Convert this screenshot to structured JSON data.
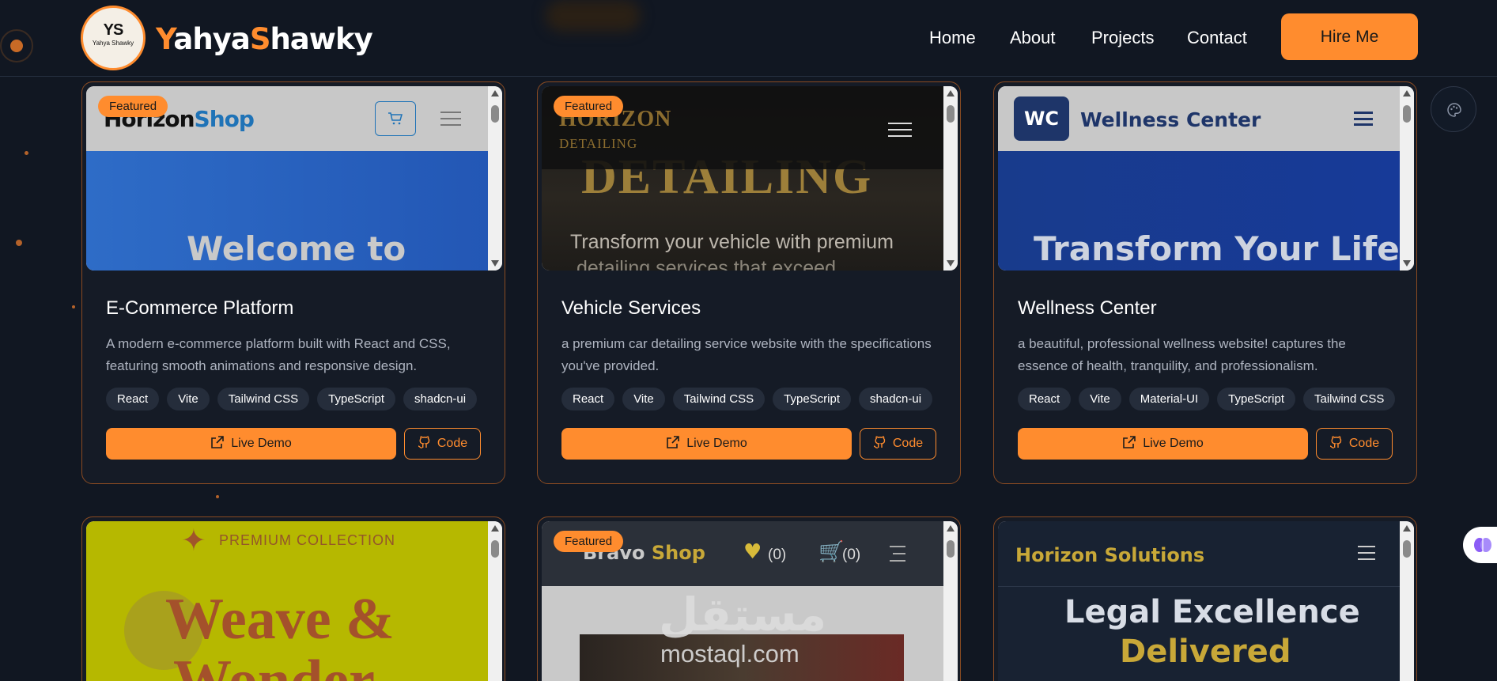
{
  "header": {
    "logo_initials": "YS",
    "logo_sub": "Yahya Shawky",
    "brand_first_initial": "Y",
    "brand_first_rest": "ahya",
    "brand_last_initial": "S",
    "brand_last_rest": "hawky",
    "nav": [
      "Home",
      "About",
      "Projects",
      "Contact"
    ],
    "cta": "Hire Me"
  },
  "badge_label": "Featured",
  "buttons": {
    "demo": "Live Demo",
    "code": "Code"
  },
  "icons": {
    "palette": "palette-icon",
    "brain": "brain-icon",
    "cart": "cart-icon",
    "heart": "heart-icon",
    "github": "github-icon",
    "external": "external-link-icon"
  },
  "colors": {
    "accent": "#ff8c2e",
    "background": "#111722",
    "card": "#151b26"
  },
  "projects": [
    {
      "title": "E-Commerce Platform",
      "description": "A modern e-commerce platform built with React and CSS, featuring smooth animations and responsive design.",
      "tags": [
        "React",
        "Vite",
        "Tailwind CSS",
        "TypeScript",
        "shadcn-ui"
      ],
      "featured": true,
      "preview": {
        "logo_a": "Horizon",
        "logo_b": "Shop",
        "hero": "Welcome to"
      }
    },
    {
      "title": "Vehicle Services",
      "description": "a premium car detailing service website with the specifications you've provided.",
      "tags": [
        "React",
        "Vite",
        "Tailwind CSS",
        "TypeScript",
        "shadcn-ui"
      ],
      "featured": true,
      "preview": {
        "logo_a": "HORIZON",
        "logo_b": "DETAILING",
        "hero": "DETAILING",
        "sub": "Transform your vehicle with premium",
        "sub2": "detailing services that exceed"
      }
    },
    {
      "title": "Wellness Center",
      "description": "a beautiful, professional wellness website! captures the essence of health, tranquility, and professionalism.",
      "tags": [
        "React",
        "Vite",
        "Material-UI",
        "TypeScript",
        "Tailwind CSS"
      ],
      "featured": false,
      "preview": {
        "box": "WC",
        "name": "Wellness Center",
        "hero": "Transform Your Life"
      }
    },
    {
      "featured": false,
      "preview": {
        "small": "PREMIUM COLLECTION",
        "hero": "Weave &",
        "hero2": "Wonder"
      }
    },
    {
      "featured": true,
      "preview": {
        "logo_a": "Bravo",
        "logo_b": "Shop",
        "wish": "(0)",
        "cart": "(0)",
        "watermark_ar": "مستقل",
        "watermark": "mostaql.com"
      }
    },
    {
      "featured": false,
      "preview": {
        "logo": "Horizon Solutions",
        "hero": "Legal Excellence",
        "hero2": "Delivered"
      }
    }
  ]
}
